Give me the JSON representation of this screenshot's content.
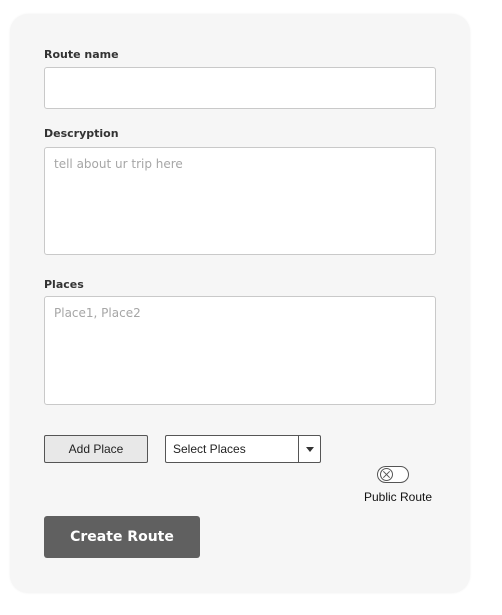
{
  "form": {
    "route_name": {
      "label": "Route name",
      "value": "",
      "placeholder": ""
    },
    "description": {
      "label": "Descryption",
      "value": "",
      "placeholder": "tell about ur trip here"
    },
    "places": {
      "label": "Places",
      "value": "",
      "placeholder": "Place1, Place2"
    },
    "add_place_label": "Add Place",
    "select_places": {
      "selected": "Select Places"
    },
    "public_route": {
      "label": "Public Route",
      "state": "off",
      "knob_icon": "x-icon"
    },
    "create_route_label": "Create Route"
  },
  "colors": {
    "card_background": "#f6f6f6",
    "primary_button": "#606060",
    "border": "#c9c9c9"
  }
}
